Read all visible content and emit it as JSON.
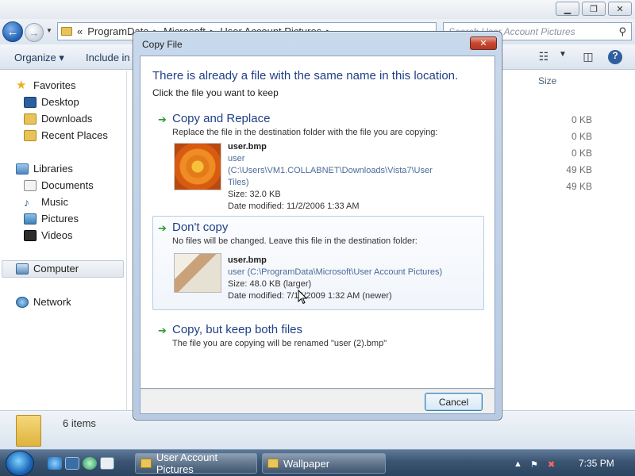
{
  "explorer": {
    "address_prefix": "«",
    "address_path": [
      "ProgramData",
      "Microsoft",
      "User Account Pictures"
    ],
    "address_sep": "▸",
    "search_placeholder": "Search User Account Pictures",
    "toolbar": {
      "organize": "Organize ▾",
      "include": "Include in l"
    },
    "sidebar": {
      "favorites": "Favorites",
      "favorites_items": [
        "Desktop",
        "Downloads",
        "Recent Places"
      ],
      "libraries": "Libraries",
      "libraries_items": [
        "Documents",
        "Music",
        "Pictures",
        "Videos"
      ],
      "computer": "Computer",
      "network": "Network"
    },
    "column_size": "Size",
    "sizes": [
      "0 KB",
      "0 KB",
      "0 KB",
      "49 KB",
      "49 KB"
    ],
    "details_count": "6 items"
  },
  "dialog": {
    "title": "Copy File",
    "close_label": "✕",
    "heading": "There is already a file with the same name in this location.",
    "subheading": "Click the file you want to keep",
    "options": [
      {
        "title": "Copy and Replace",
        "desc": "Replace the file in the destination folder with the file you are copying:",
        "file_name": "user.bmp",
        "file_path": "user (C:\\Users\\VM1.COLLABNET\\Downloads\\Vista7\\User Tiles)",
        "file_size": "Size: 32.0 KB",
        "file_modified": "Date modified: 11/2/2006 1:33 AM"
      },
      {
        "title": "Don't copy",
        "desc": "No files will be changed. Leave this file in the destination folder:",
        "file_name": "user.bmp",
        "file_path": "user (C:\\ProgramData\\Microsoft\\User Account Pictures)",
        "file_size": "Size: 48.0 KB (larger)",
        "file_modified": "Date modified: 7/14/2009 1:32 AM (newer)"
      },
      {
        "title": "Copy, but keep both files",
        "desc": "The file you are copying will be renamed \"user (2).bmp\""
      }
    ],
    "cancel_label": "Cancel"
  },
  "taskbar": {
    "buttons": [
      "User Account Pictures",
      "Wallpaper"
    ],
    "clock": "7:35 PM"
  }
}
